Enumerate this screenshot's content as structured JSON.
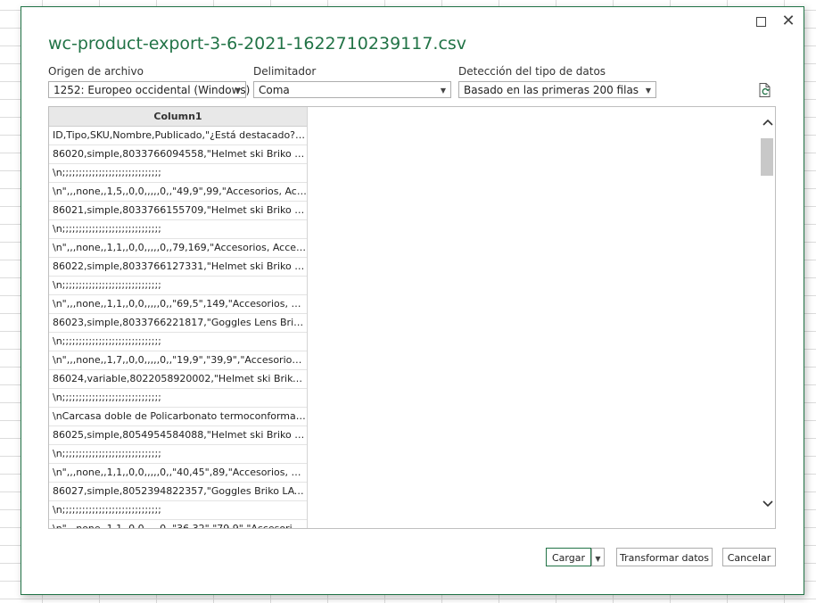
{
  "dialog": {
    "title": "wc-product-export-3-6-2021-1622710239117.csv",
    "window_controls": {
      "maximize_icon": "maximize-icon",
      "close_icon": "close-icon",
      "close_glyph": "✕"
    }
  },
  "options": {
    "origin": {
      "label": "Origen de archivo",
      "value": "1252: Europeo occidental (Windows)"
    },
    "delimiter": {
      "label": "Delimitador",
      "value": "Coma"
    },
    "datatype": {
      "label": "Detección del tipo de datos",
      "value": "Basado en las primeras 200 filas"
    },
    "refresh_icon": "refresh-icon"
  },
  "preview": {
    "column_header": "Column1",
    "rows": [
      "ID,Tipo,SKU,Nombre,Publicado,\"¿Está destacado?\",\"Visibilidad en el catálogo\"",
      "86020,simple,8033766094558,\"Helmet ski Briko KODIAK",
      "\\n;;;;;;;;;;;;;;;;;;;;;;;;;;;;;;",
      "\\n\",,,none,,1,5,,0,0,,,,,0,,\"49,9\",99,\"Accesorios, Accesorios",
      "86021,simple,8033766155709,\"Helmet ski Briko PH.X SL",
      "\\n;;;;;;;;;;;;;;;;;;;;;;;;;;;;;;",
      "\\n\",,,none,,1,1,,0,0,,,,,0,,79,169,\"Accesorios, Accesorios",
      "86022,simple,8033766127331,\"Helmet ski Briko FREEM",
      "\\n;;;;;;;;;;;;;;;;;;;;;;;;;;;;;;",
      "\\n\",,,none,,1,1,,0,0,,,,,0,,\"69,5\",149,\"Accesorios, Acceso",
      "86023,simple,8033766221817,\"Goggles Lens Briko CYLI",
      "\\n;;;;;;;;;;;;;;;;;;;;;;;;;;;;;;",
      "\\n\",,,none,,1,7,,0,0,,,,,0,,\"19,9\",\"39,9\",\"Accesorios, Acc",
      "86024,variable,8022058920002,\"Helmet ski Briko AMB",
      "\\n;;;;;;;;;;;;;;;;;;;;;;;;;;;;;;",
      "\\nCarcasa doble de Policarbonato termoconformado e",
      "86025,simple,8054954584088,\"Helmet ski Briko CANY",
      "\\n;;;;;;;;;;;;;;;;;;;;;;;;;;;;;;",
      "\\n\",,,none,,1,1,,0,0,,,,,0,,\"40,45\",89,\"Accesorios, Acceso",
      "86027,simple,8052394822357,\"Goggles Briko LAVA (col",
      "\\n;;;;;;;;;;;;;;;;;;;;;;;;;;;;;;",
      "\\n\",,,none,,1,1,,0,0,,,,,0,,\"36,32\",\"79,9\",\"Accesorios, Ac"
    ],
    "scroll_up_icon": "chevron-up-icon",
    "scroll_down_icon": "chevron-down-icon"
  },
  "buttons": {
    "load": "Cargar",
    "transform": "Transformar datos",
    "cancel": "Cancelar"
  },
  "colors": {
    "accent": "#217346"
  }
}
